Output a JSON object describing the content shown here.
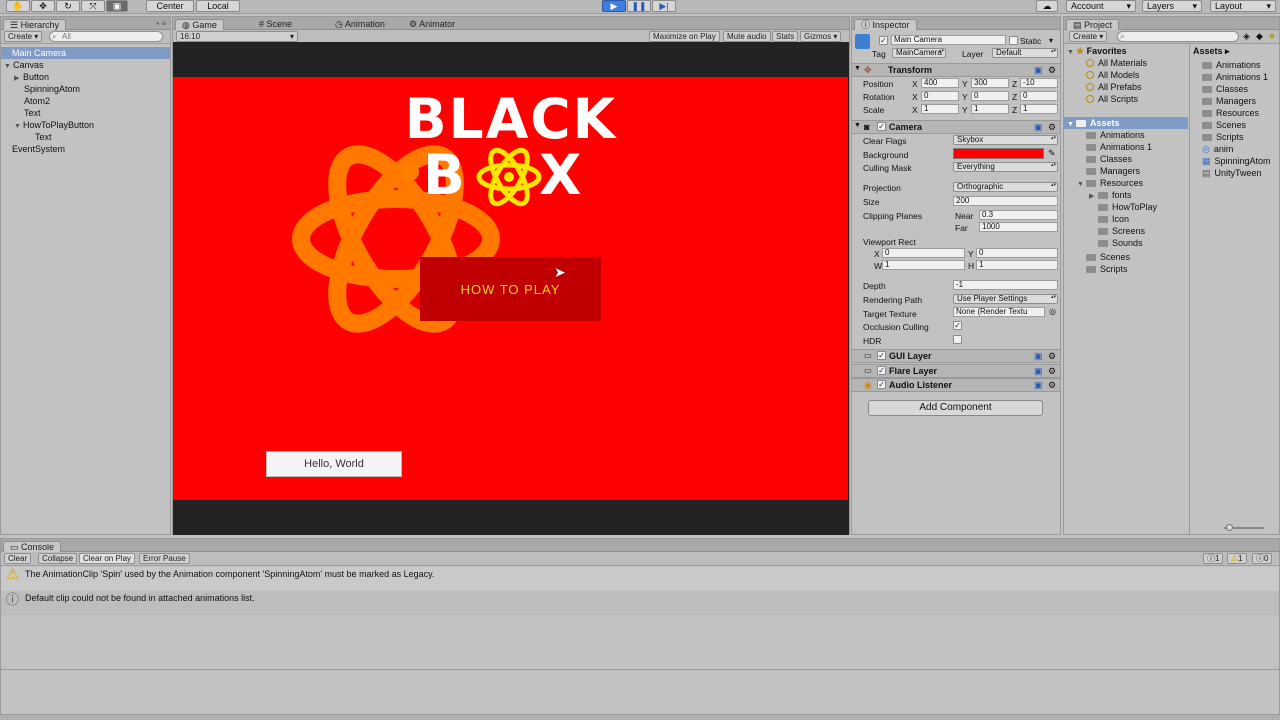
{
  "toolbar": {
    "pivot_label": "Center",
    "space_label": "Local",
    "account_label": "Account",
    "layers_label": "Layers",
    "layout_label": "Layout"
  },
  "hierarchy": {
    "tab": "Hierarchy",
    "create_label": "Create",
    "search_placeholder": "All",
    "items": [
      "Main Camera",
      "Canvas",
      "Button",
      "SpinningAtom",
      "Atom2",
      "Text",
      "HowToPlayButton",
      "Text",
      "EventSystem"
    ]
  },
  "scene_tabs": {
    "game": "Game",
    "scene": "Scene",
    "animation": "Animation",
    "animator": "Animator"
  },
  "game_bar": {
    "aspect": "16:10",
    "maximize": "Maximize on Play",
    "mute": "Mute audio",
    "stats": "Stats",
    "gizmos": "Gizmos"
  },
  "game_view": {
    "logo_line1": "BLACK",
    "logo_line2_left": "B",
    "logo_line2_right": "X",
    "how_to_play": "HOW TO PLAY",
    "hello_button": "Hello, World",
    "background_color": "#ff0000"
  },
  "inspector": {
    "tab": "Inspector",
    "object_name": "Main Camera",
    "static_label": "Static",
    "tag_label": "Tag",
    "tag_value": "MainCamera",
    "layer_label": "Layer",
    "layer_value": "Default",
    "transform": {
      "title": "Transform",
      "position_label": "Position",
      "rotation_label": "Rotation",
      "scale_label": "Scale",
      "position": {
        "x": "400",
        "y": "300",
        "z": "-10"
      },
      "rotation": {
        "x": "0",
        "y": "0",
        "z": "0"
      },
      "scale": {
        "x": "1",
        "y": "1",
        "z": "1"
      }
    },
    "camera": {
      "title": "Camera",
      "clear_flags_label": "Clear Flags",
      "clear_flags": "Skybox",
      "background_label": "Background",
      "background_color": "#ff0000",
      "culling_mask_label": "Culling Mask",
      "culling_mask": "Everything",
      "projection_label": "Projection",
      "projection": "Orthographic",
      "size_label": "Size",
      "size": "200",
      "clipping_label": "Clipping Planes",
      "near_label": "Near",
      "near": "0.3",
      "far_label": "Far",
      "far": "1000",
      "viewport_label": "Viewport Rect",
      "vp_x": "0",
      "vp_y": "0",
      "vp_w": "1",
      "vp_h": "1",
      "depth_label": "Depth",
      "depth": "-1",
      "rendering_path_label": "Rendering Path",
      "rendering_path": "Use Player Settings",
      "target_texture_label": "Target Texture",
      "target_texture": "None (Render Textu",
      "occlusion_label": "Occlusion Culling",
      "hdr_label": "HDR"
    },
    "components": [
      "GUI Layer",
      "Flare Layer",
      "Audio Listener"
    ],
    "add_component": "Add Component"
  },
  "project": {
    "tab": "Project",
    "create_label": "Create",
    "favorites_title": "Favorites",
    "favorites": [
      "All Materials",
      "All Models",
      "All Prefabs",
      "All Scripts"
    ],
    "assets_title": "Assets",
    "tree": [
      "Animations",
      "Animations 1",
      "Classes",
      "Managers",
      "Resources",
      "fonts",
      "HowToPlay",
      "Icon",
      "Screens",
      "Sounds",
      "Scenes",
      "Scripts"
    ],
    "breadcrumb": "Assets",
    "assets_list": [
      "Animations",
      "Animations 1",
      "Classes",
      "Managers",
      "Resources",
      "Scenes",
      "Scripts",
      "anim",
      "SpinningAtom",
      "UnityTween"
    ]
  },
  "console": {
    "tab": "Console",
    "clear": "Clear",
    "collapse": "Collapse",
    "clear_on_play": "Clear on Play",
    "error_pause": "Error Pause",
    "info_count": "1",
    "warn_count": "1",
    "error_count": "0",
    "messages": [
      "The AnimationClip 'Spin' used by the Animation component 'SpinningAtom' must be marked as Legacy.",
      "Default clip could not be found in attached animations list."
    ]
  }
}
